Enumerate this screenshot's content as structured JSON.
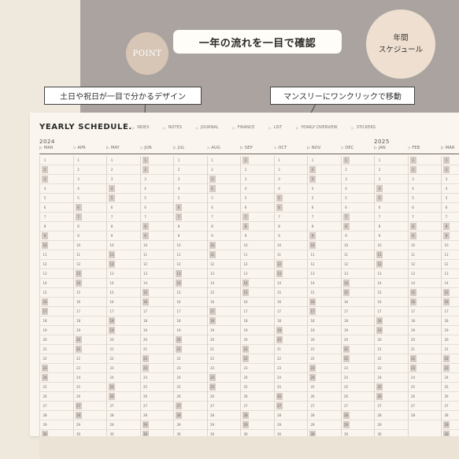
{
  "headline": "一年の流れを一目で確認",
  "point_badge": "POINT",
  "corner_badge": {
    "line1": "年間",
    "line2": "スケジュール"
  },
  "callouts": {
    "left": "土日や祝日が一目で分かるデザイン",
    "right": "マンスリーにワンクリックで移動"
  },
  "sheet": {
    "title": "YEARLY SCHEDULE.",
    "menu": [
      "INDEX",
      "NOTES",
      "JOURNAL",
      "FINANCE",
      "LIST",
      "YEARLY OVERVIEW",
      "STICKERS"
    ],
    "years": [
      "2024",
      "2025"
    ],
    "months": [
      "MAR",
      "APR",
      "MAY",
      "JUN",
      "JUL",
      "AUG",
      "SEP",
      "OCT",
      "NOV",
      "DEC",
      "JAN",
      "FEB",
      "MAR"
    ],
    "day_numbers": [
      "1",
      "2",
      "3",
      "4",
      "5",
      "6",
      "7",
      "8",
      "9",
      "10",
      "11",
      "12",
      "13",
      "14",
      "15",
      "16",
      "17",
      "18",
      "19",
      "20",
      "21",
      "22",
      "23",
      "24",
      "25",
      "26",
      "27",
      "28",
      "29",
      "30",
      "31"
    ]
  },
  "colors": {
    "hero": "#aaa39f",
    "badge": "#d7c6b6",
    "corner_badge": "#eedfd0",
    "weekend_fill": "#d5cbc4",
    "sheet": "#faf6ef"
  }
}
